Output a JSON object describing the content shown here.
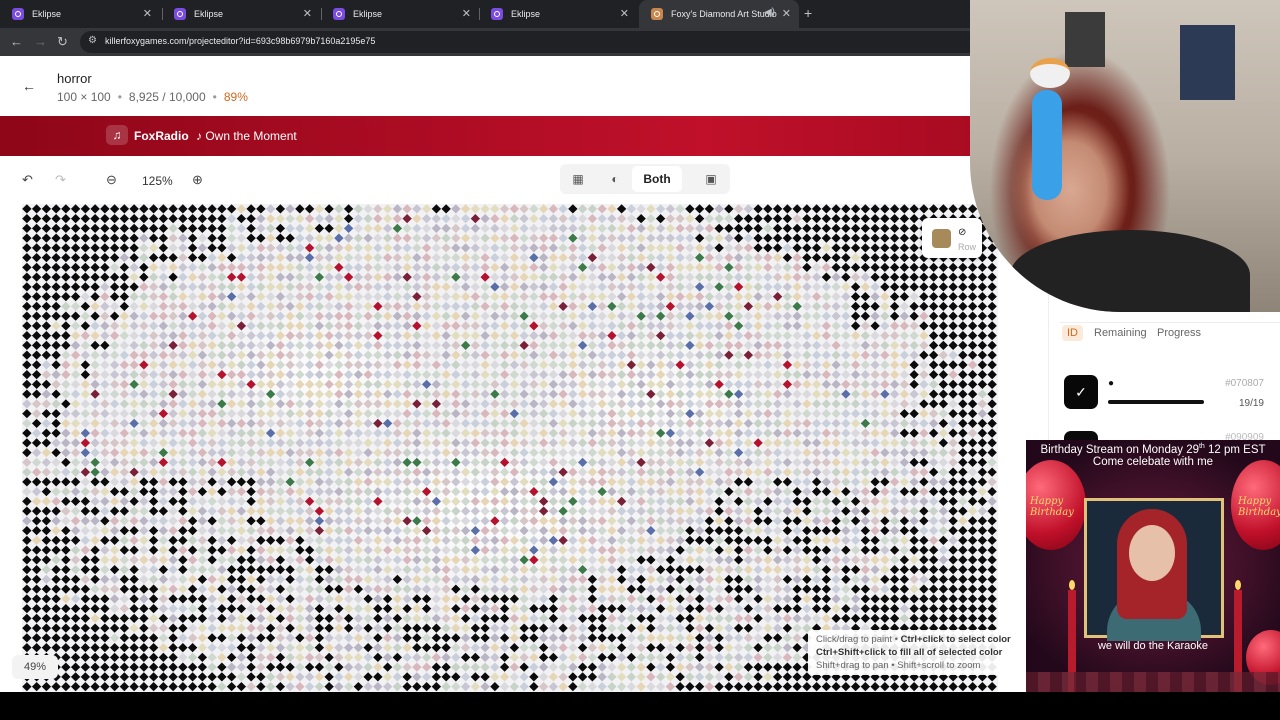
{
  "browser": {
    "tabs": [
      {
        "title": "Eklipse"
      },
      {
        "title": "Eklipse"
      },
      {
        "title": "Eklipse"
      },
      {
        "title": "Eklipse"
      },
      {
        "title": "Foxy's Diamond Art Studio",
        "active": true
      }
    ],
    "url": "killerfoxygames.com/projecteditor?id=693c98b6979b7160a2195e75"
  },
  "project": {
    "title": "horror",
    "size": "100 × 100",
    "placed": "8,925 / 10,000",
    "percent": "89%"
  },
  "radio": {
    "station": "FoxRadio",
    "song": "♪ Own the Moment"
  },
  "toolbar": {
    "zoom": "125%",
    "view_mode": "Both"
  },
  "canvas": {
    "zoom_badge": "49%",
    "hint_line1_a": "Click/drag to paint • ",
    "hint_line1_b": "Ctrl+click to select color",
    "hint_line2": "Ctrl+Shift+click to fill all of selected color",
    "hint_line3": "Shift+drag to pan • Shift+scroll to zoom"
  },
  "selected": {
    "label": "Row",
    "swatch": "#a78a5a"
  },
  "palette": {
    "sort_tabs": [
      "ID",
      "Remaining",
      "Progress"
    ],
    "active_sort": "ID",
    "rows": [
      {
        "code": "#070807",
        "count": "19/19",
        "swatch": "#070807"
      },
      {
        "code": "#090909",
        "swatch": "#0a0a0a"
      }
    ]
  },
  "overlay": {
    "line1": "Birthday Stream on Monday 29",
    "line1_sup": "th",
    "line1_end": " 12 pm EST",
    "line2": "Come celebate with me",
    "footer": "we will do the Karaoke",
    "balloon_left": "Happy Birthday",
    "balloon_right": "Happy Birthday"
  },
  "colors": {
    "accent": "#d2691e",
    "banner": "#b0102a"
  }
}
